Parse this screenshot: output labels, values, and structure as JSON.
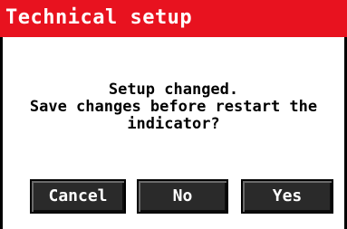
{
  "header": {
    "title": "Technical setup"
  },
  "dialog": {
    "message_lines": [
      "Setup changed.",
      "Save changes before restart the",
      "indicator?"
    ]
  },
  "buttons": {
    "cancel_label": "Cancel",
    "no_label": "No",
    "yes_label": "Yes"
  },
  "colors": {
    "title_bar": "#e8121f",
    "button_bg": "#2a2a2a",
    "text": "#000000",
    "title_text": "#ffffff"
  }
}
